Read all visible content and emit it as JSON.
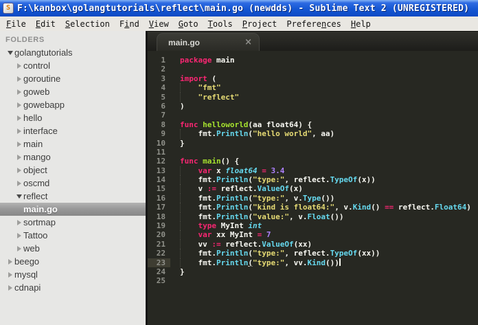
{
  "window": {
    "title": "F:\\kanbox\\golangtutorials\\reflect\\main.go (newdds) - Sublime Text 2 (UNREGISTERED)",
    "icon_glyph": "S"
  },
  "menu": [
    {
      "label": "File",
      "m": 0
    },
    {
      "label": "Edit",
      "m": 0
    },
    {
      "label": "Selection",
      "m": 0
    },
    {
      "label": "Find",
      "m": 1
    },
    {
      "label": "View",
      "m": 0
    },
    {
      "label": "Goto",
      "m": 0
    },
    {
      "label": "Tools",
      "m": 0
    },
    {
      "label": "Project",
      "m": 0
    },
    {
      "label": "Preferences",
      "m": 7
    },
    {
      "label": "Help",
      "m": 0
    }
  ],
  "sidebar": {
    "header": "FOLDERS",
    "items": [
      {
        "label": "golangtutorials",
        "depth": 0,
        "kind": "folder",
        "expanded": true
      },
      {
        "label": "control",
        "depth": 1,
        "kind": "folder",
        "expanded": false
      },
      {
        "label": "goroutine",
        "depth": 1,
        "kind": "folder",
        "expanded": false
      },
      {
        "label": "goweb",
        "depth": 1,
        "kind": "folder",
        "expanded": false
      },
      {
        "label": "gowebapp",
        "depth": 1,
        "kind": "folder",
        "expanded": false
      },
      {
        "label": "hello",
        "depth": 1,
        "kind": "folder",
        "expanded": false
      },
      {
        "label": "interface",
        "depth": 1,
        "kind": "folder",
        "expanded": false
      },
      {
        "label": "main",
        "depth": 1,
        "kind": "folder",
        "expanded": false
      },
      {
        "label": "mango",
        "depth": 1,
        "kind": "folder",
        "expanded": false
      },
      {
        "label": "object",
        "depth": 1,
        "kind": "folder",
        "expanded": false
      },
      {
        "label": "oscmd",
        "depth": 1,
        "kind": "folder",
        "expanded": false
      },
      {
        "label": "reflect",
        "depth": 1,
        "kind": "folder",
        "expanded": true
      },
      {
        "label": "main.go",
        "depth": 2,
        "kind": "file",
        "selected": true
      },
      {
        "label": "sortmap",
        "depth": 1,
        "kind": "folder",
        "expanded": false
      },
      {
        "label": "Tattoo",
        "depth": 1,
        "kind": "folder",
        "expanded": false
      },
      {
        "label": "web",
        "depth": 1,
        "kind": "folder",
        "expanded": false
      },
      {
        "label": "beego",
        "depth": 0,
        "kind": "folder",
        "expanded": false
      },
      {
        "label": "mysql",
        "depth": 0,
        "kind": "folder",
        "expanded": false
      },
      {
        "label": "cdnapi",
        "depth": 0,
        "kind": "folder",
        "expanded": false
      }
    ]
  },
  "tab": {
    "label": "main.go",
    "close": "×"
  },
  "colors": {
    "titlebar": "#1557d3",
    "menubar_bg": "#e9e7e2",
    "sidebar_bg": "#e7e7e5",
    "sidebar_selection": "#9a9a9a",
    "editor_bg": "#272822",
    "gutter_fg": "#90918a",
    "current_line_gutter": "#3e3d32",
    "keyword": "#f92672",
    "string": "#e6db74",
    "function": "#66d9ef",
    "type_italic": "#66d9ef",
    "func_name": "#a6e22e",
    "number": "#ae81ff",
    "plain": "#f8f8f2"
  },
  "code": {
    "lines": [
      {
        "n": 1,
        "guide": false,
        "current": false,
        "t": [
          [
            "k",
            "package"
          ],
          [
            "p",
            " main"
          ]
        ]
      },
      {
        "n": 2,
        "guide": false,
        "current": false,
        "t": []
      },
      {
        "n": 3,
        "guide": false,
        "current": false,
        "t": [
          [
            "k",
            "import"
          ],
          [
            "p",
            " ("
          ]
        ]
      },
      {
        "n": 4,
        "guide": true,
        "current": false,
        "t": [
          [
            "p",
            "    "
          ],
          [
            "s",
            "\"fmt\""
          ]
        ]
      },
      {
        "n": 5,
        "guide": true,
        "current": false,
        "t": [
          [
            "p",
            "    "
          ],
          [
            "s",
            "\"reflect\""
          ]
        ]
      },
      {
        "n": 6,
        "guide": false,
        "current": false,
        "t": [
          [
            "p",
            ")"
          ]
        ]
      },
      {
        "n": 7,
        "guide": false,
        "current": false,
        "t": []
      },
      {
        "n": 8,
        "guide": false,
        "current": false,
        "t": [
          [
            "k",
            "func"
          ],
          [
            "p",
            " "
          ],
          [
            "fn",
            "helloworld"
          ],
          [
            "p",
            "(aa float64) {"
          ]
        ]
      },
      {
        "n": 9,
        "guide": true,
        "current": false,
        "t": [
          [
            "p",
            "    fmt."
          ],
          [
            "f",
            "Println"
          ],
          [
            "p",
            "("
          ],
          [
            "s",
            "\"hello world\""
          ],
          [
            "p",
            ", aa)"
          ]
        ]
      },
      {
        "n": 10,
        "guide": false,
        "current": false,
        "t": [
          [
            "p",
            "}"
          ]
        ]
      },
      {
        "n": 11,
        "guide": false,
        "current": false,
        "t": []
      },
      {
        "n": 12,
        "guide": false,
        "current": false,
        "t": [
          [
            "k",
            "func"
          ],
          [
            "p",
            " "
          ],
          [
            "fn",
            "main"
          ],
          [
            "p",
            "() {"
          ]
        ]
      },
      {
        "n": 13,
        "guide": true,
        "current": false,
        "t": [
          [
            "p",
            "    "
          ],
          [
            "k",
            "var"
          ],
          [
            "p",
            " x "
          ],
          [
            "t",
            "float64"
          ],
          [
            "p",
            " "
          ],
          [
            "o",
            "="
          ],
          [
            "p",
            " "
          ],
          [
            "n",
            "3.4"
          ]
        ]
      },
      {
        "n": 14,
        "guide": true,
        "current": false,
        "t": [
          [
            "p",
            "    fmt."
          ],
          [
            "f",
            "Println"
          ],
          [
            "p",
            "("
          ],
          [
            "s",
            "\"type:\""
          ],
          [
            "p",
            ", reflect."
          ],
          [
            "f",
            "TypeOf"
          ],
          [
            "p",
            "(x))"
          ]
        ]
      },
      {
        "n": 15,
        "guide": true,
        "current": false,
        "t": [
          [
            "p",
            "    v "
          ],
          [
            "o",
            ":="
          ],
          [
            "p",
            " reflect."
          ],
          [
            "f",
            "ValueOf"
          ],
          [
            "p",
            "(x)"
          ]
        ]
      },
      {
        "n": 16,
        "guide": true,
        "current": false,
        "t": [
          [
            "p",
            "    fmt."
          ],
          [
            "f",
            "Println"
          ],
          [
            "p",
            "("
          ],
          [
            "s",
            "\"type:\""
          ],
          [
            "p",
            ", v."
          ],
          [
            "f",
            "Type"
          ],
          [
            "p",
            "())"
          ]
        ]
      },
      {
        "n": 17,
        "guide": true,
        "current": false,
        "t": [
          [
            "p",
            "    fmt."
          ],
          [
            "f",
            "Println"
          ],
          [
            "p",
            "("
          ],
          [
            "s",
            "\"kind is float64:\""
          ],
          [
            "p",
            ", v."
          ],
          [
            "f",
            "Kind"
          ],
          [
            "p",
            "() "
          ],
          [
            "o",
            "=="
          ],
          [
            "p",
            " reflect."
          ],
          [
            "f",
            "Float64"
          ],
          [
            "p",
            ")"
          ]
        ]
      },
      {
        "n": 18,
        "guide": true,
        "current": false,
        "t": [
          [
            "p",
            "    fmt."
          ],
          [
            "f",
            "Println"
          ],
          [
            "p",
            "("
          ],
          [
            "s",
            "\"value:\""
          ],
          [
            "p",
            ", v."
          ],
          [
            "f",
            "Float"
          ],
          [
            "p",
            "())"
          ]
        ]
      },
      {
        "n": 19,
        "guide": true,
        "current": false,
        "t": [
          [
            "p",
            "    "
          ],
          [
            "k",
            "type"
          ],
          [
            "p",
            " MyInt "
          ],
          [
            "t",
            "int"
          ]
        ]
      },
      {
        "n": 20,
        "guide": true,
        "current": false,
        "t": [
          [
            "p",
            "    "
          ],
          [
            "k",
            "var"
          ],
          [
            "p",
            " xx MyInt "
          ],
          [
            "o",
            "="
          ],
          [
            "p",
            " "
          ],
          [
            "n",
            "7"
          ]
        ]
      },
      {
        "n": 21,
        "guide": true,
        "current": false,
        "t": [
          [
            "p",
            "    vv "
          ],
          [
            "o",
            ":="
          ],
          [
            "p",
            " reflect."
          ],
          [
            "f",
            "ValueOf"
          ],
          [
            "p",
            "(xx)"
          ]
        ]
      },
      {
        "n": 22,
        "guide": true,
        "current": false,
        "t": [
          [
            "p",
            "    fmt."
          ],
          [
            "f",
            "Println"
          ],
          [
            "p",
            "("
          ],
          [
            "s",
            "\"type:\""
          ],
          [
            "p",
            ", reflect."
          ],
          [
            "f",
            "TypeOf"
          ],
          [
            "p",
            "(xx))"
          ]
        ]
      },
      {
        "n": 23,
        "guide": true,
        "current": true,
        "t": [
          [
            "p",
            "    fmt."
          ],
          [
            "f",
            "Println"
          ],
          [
            "pu",
            "("
          ],
          [
            "s",
            "\"type:\""
          ],
          [
            "p",
            ", vv."
          ],
          [
            "f",
            "Kind"
          ],
          [
            "p",
            "())"
          ],
          [
            "caret",
            ""
          ]
        ]
      },
      {
        "n": 24,
        "guide": false,
        "current": false,
        "t": [
          [
            "p",
            "}"
          ]
        ]
      },
      {
        "n": 25,
        "guide": false,
        "current": false,
        "t": []
      }
    ]
  }
}
